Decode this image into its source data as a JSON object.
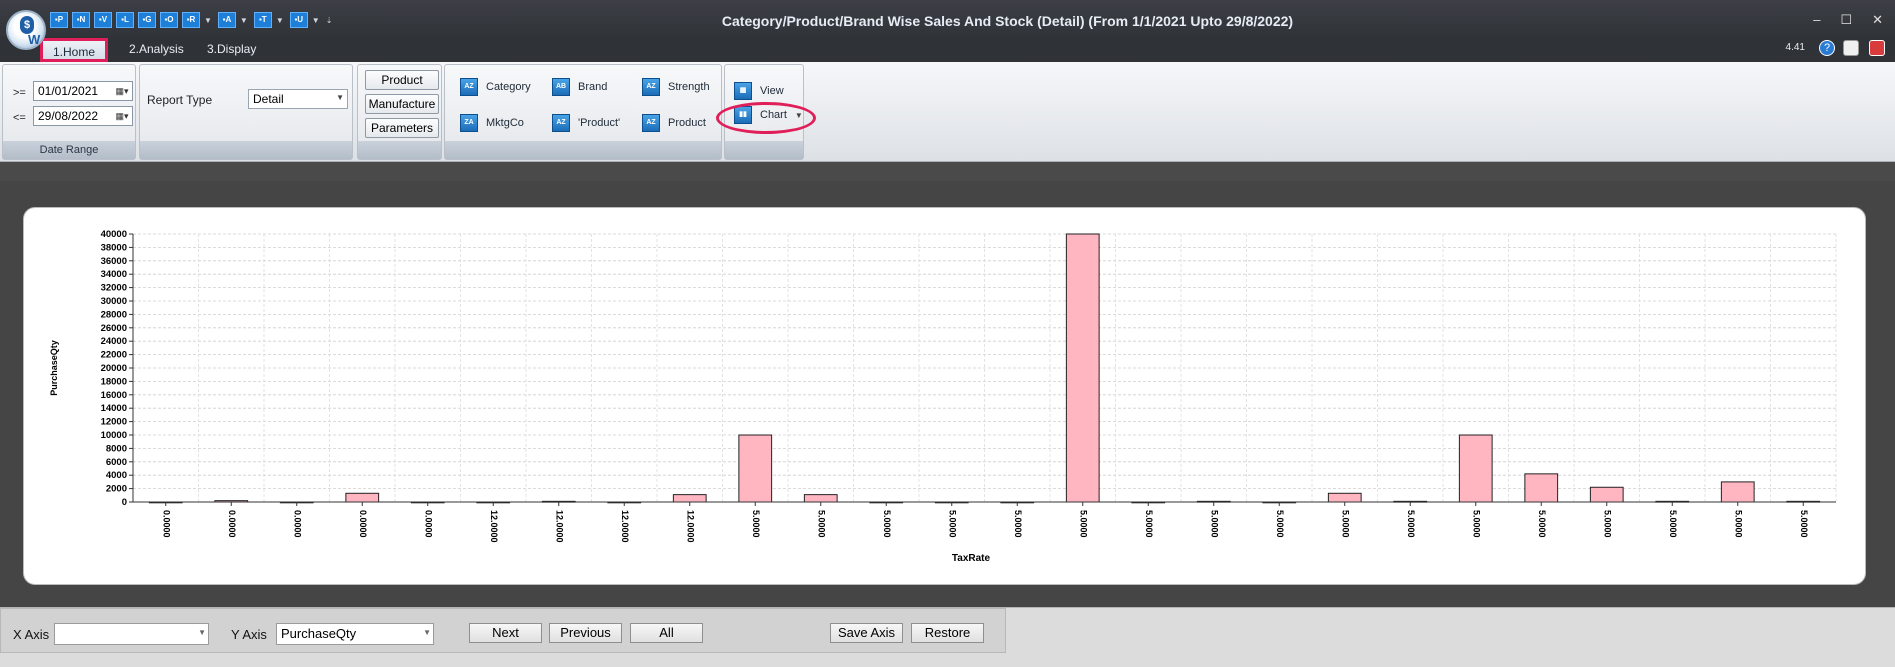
{
  "window": {
    "title": "Category/Product/Brand Wise Sales And Stock (Detail)  (From 1/1/2021 Upto 29/8/2022)",
    "version": "4.41",
    "minimize": "–",
    "maximize": "☐",
    "close": "✕"
  },
  "qat": [
    "▪P",
    "▪N",
    "▪V",
    "▪L",
    "▪G",
    "▪O",
    "▪R",
    "▪A",
    "▪T",
    "▪U"
  ],
  "tabs": {
    "home": "1.Home",
    "analysis": "2.Analysis",
    "display": "3.Display"
  },
  "date_range": {
    "from_label": ">=",
    "from_value": "01/01/2021",
    "to_label": "<=",
    "to_value": "29/08/2022",
    "group_label": "Date Range"
  },
  "report": {
    "label": "Report Type",
    "value": "Detail"
  },
  "buttons": {
    "product": "Product",
    "manufacture": "Manufacture",
    "parameters": "Parameters"
  },
  "analysis_items": {
    "category": "Category",
    "brand": "Brand",
    "strength": "Strength",
    "mktgco": "MktgCo",
    "product_q": "'Product'",
    "product": "Product"
  },
  "view_group": {
    "view": "View",
    "chart": "Chart"
  },
  "chart_data": {
    "type": "bar",
    "xlabel": "TaxRate",
    "ylabel": "PurchaseQty",
    "ylim": [
      0,
      40000
    ],
    "yticks": [
      0,
      2000,
      4000,
      6000,
      8000,
      10000,
      12000,
      14000,
      16000,
      18000,
      20000,
      22000,
      24000,
      26000,
      28000,
      30000,
      32000,
      34000,
      36000,
      38000,
      40000
    ],
    "categories": [
      "0.0000",
      "0.0000",
      "0.0000",
      "0.0000",
      "0.0000",
      "12.0000",
      "12.0000",
      "12.0000",
      "12.0000",
      "5.0000",
      "5.0000",
      "5.0000",
      "5.0000",
      "5.0000",
      "5.0000",
      "5.0000",
      "5.0000",
      "5.0000",
      "5.0000",
      "5.0000",
      "5.0000",
      "5.0000",
      "5.0000",
      "5.0000",
      "5.0000",
      "5.0000"
    ],
    "values": [
      0,
      200,
      0,
      1300,
      0,
      0,
      100,
      0,
      1100,
      10000,
      1100,
      0,
      0,
      0,
      40000,
      0,
      100,
      0,
      1300,
      100,
      10000,
      4200,
      2200,
      100,
      3000,
      100
    ],
    "bar_color": "#ffb6c1"
  },
  "bottom": {
    "x_axis_label": "X Axis",
    "x_axis_value": "",
    "y_axis_label": "Y Axis",
    "y_axis_value": "PurchaseQty",
    "next": "Next",
    "previous": "Previous",
    "all": "All",
    "save_axis": "Save Axis",
    "restore": "Restore"
  }
}
